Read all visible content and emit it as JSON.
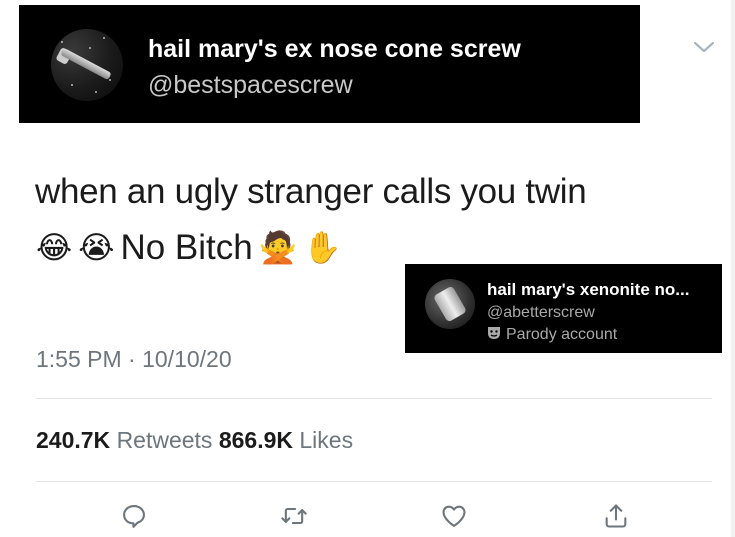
{
  "overlay_top": {
    "name": "hail mary's ex nose cone screw",
    "handle": "@bestspacescrew",
    "avatar_icon": "screw-icon"
  },
  "tweet": {
    "line1": "when an ugly stranger calls you twin",
    "line2_emojis_pre": [
      "😂",
      "😭"
    ],
    "line2_text": "No Bitch",
    "line2_emojis_post": [
      "🙅",
      "✋"
    ],
    "timestamp": "1:55 PM · 10/10/20",
    "stats": {
      "retweets_count": "240.7K",
      "retweets_label": "Retweets",
      "likes_count": "866.9K",
      "likes_label": "Likes"
    },
    "actions": [
      "reply-icon",
      "retweet-icon",
      "like-icon",
      "share-icon"
    ]
  },
  "overlay_card": {
    "name": "hail mary's xenonite no...",
    "handle": "@abetterscrew",
    "parody_label": "Parody account",
    "parody_icon": "masks-icon",
    "avatar_icon": "bolt-icon"
  },
  "colors": {
    "banner_bg": "#000000",
    "text_primary": "#1b1b1b",
    "text_secondary": "#6e767d"
  }
}
